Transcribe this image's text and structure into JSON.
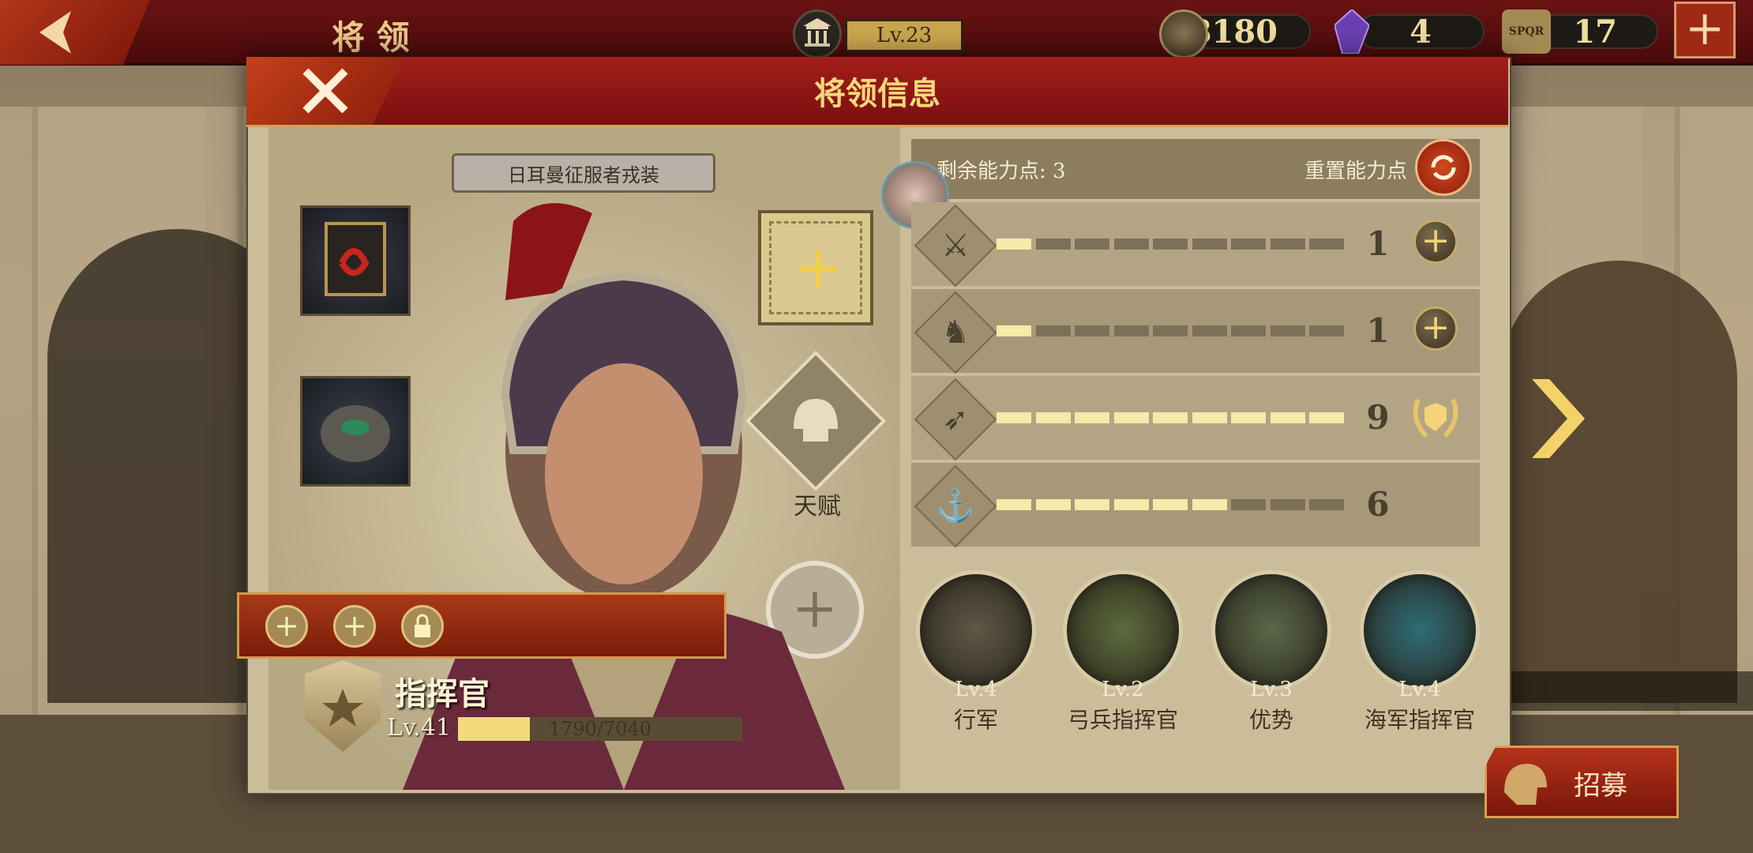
{
  "top_bar": {
    "page_title": "将 领",
    "city_level": "Lv.23",
    "coins": "8180",
    "gems": "4",
    "tokens": "17",
    "token_badge": "SPQR"
  },
  "dialog": {
    "title": "将领信息",
    "costume_name": "日耳曼征服者戎装",
    "talent_label": "天赋",
    "commander": {
      "title": "指挥官",
      "level": "Lv.41",
      "exp_text": "1790/7040",
      "exp_fraction": 0.254
    },
    "ability": {
      "remaining_label": "剩余能力点:",
      "remaining_value": "3",
      "reset_label": "重置能力点",
      "stats": [
        {
          "icon": "sword-icon",
          "value": "1",
          "filled": 1,
          "segments": 9,
          "action": "plus"
        },
        {
          "icon": "horse-icon",
          "value": "1",
          "filled": 1,
          "segments": 9,
          "action": "plus"
        },
        {
          "icon": "bow-icon",
          "value": "9",
          "filled": 9,
          "segments": 9,
          "action": "max"
        },
        {
          "icon": "anchor-icon",
          "value": "6",
          "filled": 6,
          "segments": 9,
          "action": "none"
        }
      ]
    },
    "skills": [
      {
        "level": "Lv.4",
        "name": "行军",
        "icon": "march-icon",
        "color": "#5e5846"
      },
      {
        "level": "Lv.2",
        "name": "弓兵指挥官",
        "icon": "bow-icon",
        "color": "#5d6b3d"
      },
      {
        "level": "Lv.3",
        "name": "优势",
        "icon": "archers-icon",
        "color": "#5a6848"
      },
      {
        "level": "Lv.4",
        "name": "海军指挥官",
        "icon": "anchor-icon",
        "color": "#2f6c78"
      }
    ]
  },
  "recruit_label": "招募",
  "colors": {
    "accent_red": "#8a1414",
    "gold": "#f5d46a",
    "parchment": "#cbbd9a"
  }
}
